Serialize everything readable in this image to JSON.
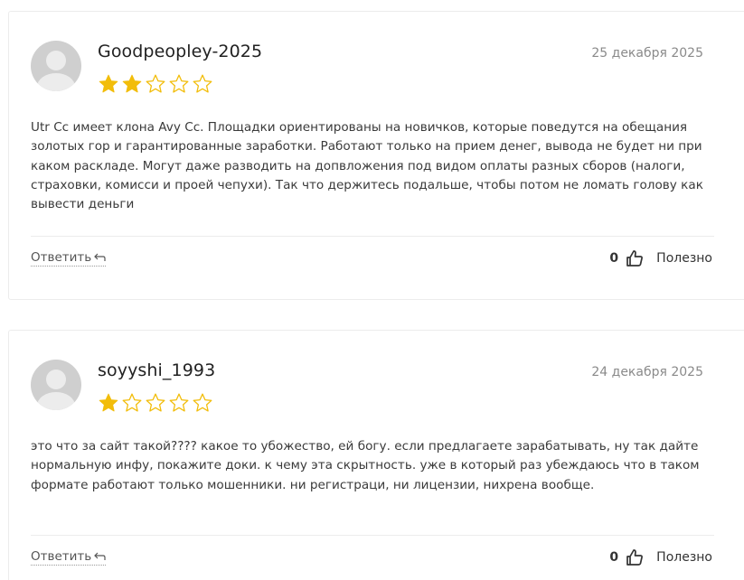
{
  "reviews": [
    {
      "username": "Goodpeopley-2025",
      "date": "25 декабря 2025",
      "rating": 2,
      "max_rating": 5,
      "text": "Utr Cc имеет клона Avy Cc. Площадки ориентированы на новичков, которые поведутся на обещания золотых гор и гарантированные заработки. Работают только на прием денег, вывода не будет ни при каком раскладе. Могут даже разводить на допвложения под видом оплаты разных сборов (налоги, страховки, комисси и проей чепухи). Так что держитесь подальше, чтобы потом не ломать голову как вывести деньги",
      "reply_label": "Ответить",
      "helpful_count": "0",
      "helpful_label": "Полезно"
    },
    {
      "username": "soyyshi_1993",
      "date": "24 декабря 2025",
      "rating": 1,
      "max_rating": 5,
      "text": "это что за сайт такой???? какое то убожество, ей богу. если предлагаете зарабатывать, ну так дайте нормальную инфу, покажите доки. к чему эта скрытность. уже в который раз убеждаюсь что в таком формате работают только мошенники. ни регистраци, ни лицензии, нихрена вообще.",
      "reply_label": "Ответить",
      "helpful_count": "0",
      "helpful_label": "Полезно"
    }
  ],
  "colors": {
    "star_filled": "#f2bd0b",
    "star_outline": "#f2bd0b",
    "text": "#3a3a3a",
    "date": "#8a8a8a"
  },
  "icons": {
    "reply": "reply-arrow-icon",
    "helpful": "thumbs-up-icon",
    "star_filled": "star-filled-icon",
    "star_empty": "star-outline-icon",
    "avatar": "user-avatar-placeholder-icon"
  }
}
